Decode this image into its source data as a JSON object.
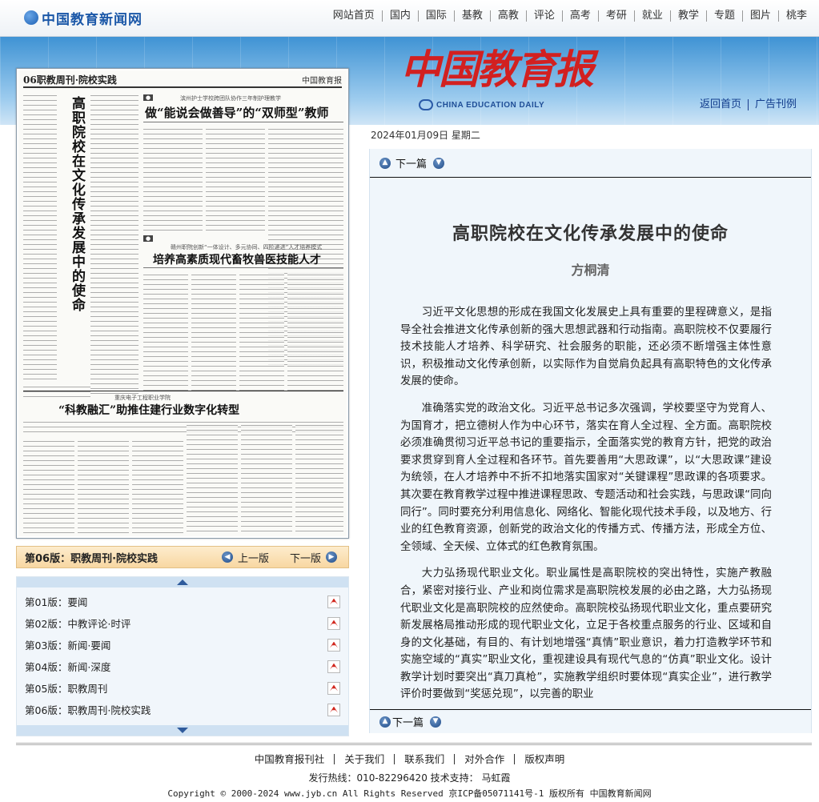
{
  "site": {
    "logo_text": "中国教育新闻网",
    "nav": [
      "网站首页",
      "国内",
      "国际",
      "基教",
      "高教",
      "评论",
      "高考",
      "考研",
      "就业",
      "教学",
      "专题",
      "图片",
      "桃李"
    ]
  },
  "masthead": {
    "logo_cn": "中国教育报",
    "logo_en": "CHINA EDUCATION DAILY",
    "links": [
      "返回首页",
      "广告刊例"
    ]
  },
  "date": "2024年01月09日  星期二",
  "paper_image": {
    "section": "06职教周刊·院校实践",
    "brand": "中国教育报",
    "vertical_title": "高职院校在文化传承发展中的使命",
    "headline1_kicker": "滨州护士学校跨团队协作三年制护理教学",
    "headline1": "做“能说会做善导”的“双师型”教师",
    "headline2_kicker": "赣州职院创新“一体设计、多元协同、四阶递进”人才培养模式",
    "headline2": "培养高素质现代畜牧兽医技能人才",
    "headline3_kicker": "重庆电子工程职业学院",
    "headline3": "“科教融汇”助推住建行业数字化转型"
  },
  "article": {
    "next_label": "下一篇",
    "title": "高职院校在文化传承发展中的使命",
    "author": "方桐清",
    "paragraphs": [
      "习近平文化思想的形成在我国文化发展史上具有重要的里程碑意义，是指导全社会推进文化传承创新的强大思想武器和行动指南。高职院校不仅要履行技术技能人才培养、科学研究、社会服务的职能，还必须不断增强主体性意识，积极推动文化传承创新，以实际作为自觉肩负起具有高职特色的文化传承发展的使命。",
      "准确落实党的政治文化。习近平总书记多次强调，学校要坚守为党育人、为国育才，把立德树人作为中心环节，落实在育人全过程、全方面。高职院校必须准确贯彻习近平总书记的重要指示，全面落实党的教育方针，把党的政治要求贯穿到育人全过程和各环节。首先要善用“大思政课”，以“大思政课”建设为统领，在人才培养中不折不扣地落实国家对“关键课程”思政课的各项要求。其次要在教育教学过程中推进课程思政、专题活动和社会实践，与思政课“同向同行”。同时要充分利用信息化、网络化、智能化现代技术手段，以及地方、行业的红色教育资源，创新党的政治文化的传播方式、传播方法，形成全方位、全领域、全天候、立体式的红色教育氛围。",
      "大力弘扬现代职业文化。职业属性是高职院校的突出特性，实施产教融合，紧密对接行业、产业和岗位需求是高职院校发展的必由之路，大力弘扬现代职业文化是高职院校的应然使命。高职院校弘扬现代职业文化，重点要研究新发展格局推动形成的现代职业文化，立足于各校重点服务的行业、区域和自身的文化基础，有目的、有计划地增强“真情”职业意识，着力打造教学环节和实施空域的“真实”职业文化，重视建设具有现代气息的“仿真”职业文化。设计教学计划时要突出“真刀真枪”，实施教学组织时要体现“真实企业”，进行教学评价时要做到“奖惩兑现”，以完善的职业"
    ]
  },
  "page_nav": {
    "current": "第06版：职教周刊·院校实践",
    "prev_label": "上一版",
    "next_label": "下一版",
    "pages": [
      "第01版：要闻",
      "第02版：中教评论·时评",
      "第03版：新闻·要闻",
      "第04版：新闻·深度",
      "第05版：职教周刊",
      "第06版：职教周刊·院校实践"
    ]
  },
  "footer": {
    "links": [
      "中国教育报刊社",
      "关于我们",
      "联系我们",
      "对外合作",
      "版权声明"
    ],
    "hotline": "发行热线：010-82296420  技术支持： 马虹霞",
    "copyright": "Copyright © 2000-2024 www.jyb.cn All Rights Reserved 京ICP备05071141号-1 版权所有 中国教育新闻网"
  },
  "colors": {
    "brand_red": "#d22020",
    "link_blue": "#123c8c",
    "band_blue": "#3f93d4",
    "panel_bg": "#f0f6fb",
    "page_bar": "#f8d7a2"
  }
}
